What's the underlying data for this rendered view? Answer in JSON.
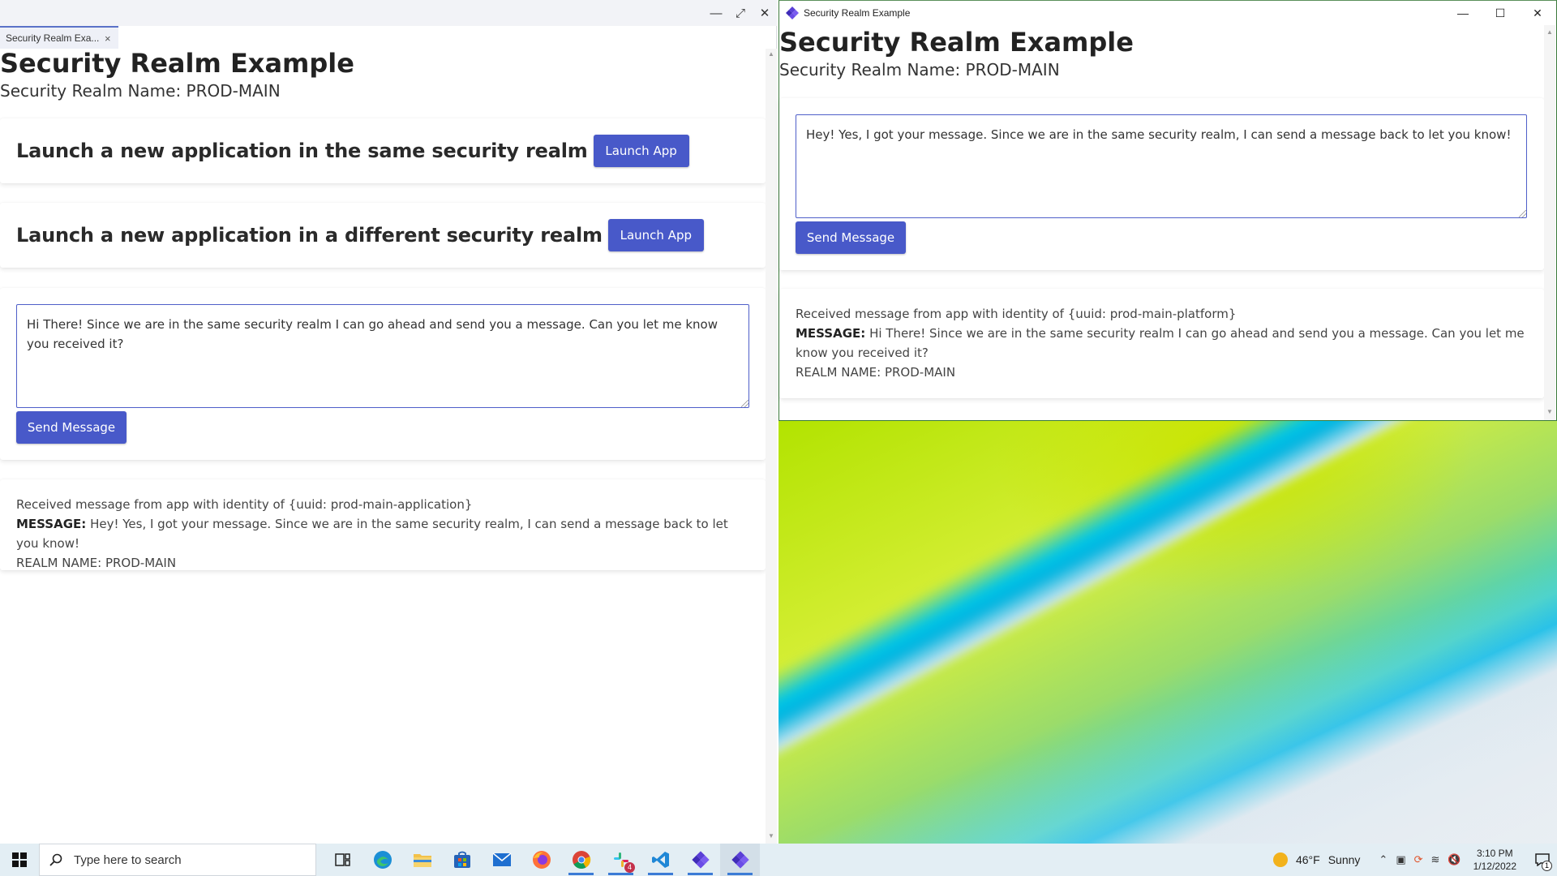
{
  "left_window": {
    "tab_label": "Security Realm Exa...",
    "tab_close": "×",
    "title": "Security Realm Example",
    "realm_name": "Security Realm Name: PROD-MAIN",
    "launch_same": {
      "heading": "Launch a new application in the same security realm",
      "button": "Launch App"
    },
    "launch_different": {
      "heading": "Launch a new application in a different security realm",
      "button": "Launch App"
    },
    "message_input": {
      "value": "Hi There! Since we are in the same security realm I can go ahead and send you a message. Can you let me know you received it?"
    },
    "send_button": "Send Message",
    "received": {
      "line1": "Received message from app with identity of {uuid: prod-main-application}",
      "message_label": "MESSAGE:",
      "message_text": "Hey! Yes, I got your message. Since we are in the same security realm, I can send a message back to let you know!",
      "realm": "REALM NAME: PROD-MAIN"
    }
  },
  "right_window": {
    "window_title": "Security Realm Example",
    "title": "Security Realm Example",
    "realm_name": "Security Realm Name: PROD-MAIN",
    "message_input": {
      "value": "Hey! Yes, I got your message. Since we are in the same security realm, I can send a message back to let you know!"
    },
    "send_button": "Send Message",
    "received": {
      "line1": "Received message from app with identity of {uuid: prod-main-platform}",
      "message_label": "MESSAGE:",
      "message_text": "Hi There! Since we are in the same security realm I can go ahead and send you a message. Can you let me know you received it?",
      "realm": "REALM NAME: PROD-MAIN"
    }
  },
  "taskbar": {
    "search_placeholder": "Type here to search",
    "apps": [
      "task-view",
      "edge",
      "file-explorer",
      "microsoft-store",
      "mail",
      "firefox",
      "chrome",
      "slack",
      "vscode",
      "openfin",
      "openfin"
    ],
    "slack_badge": "4",
    "weather_temp": "46°F",
    "weather_text": "Sunny",
    "time": "3:10 PM",
    "date": "1/12/2022",
    "notification_count": "1"
  },
  "colors": {
    "primary_button": "#4859c9",
    "textarea_border": "#4f5fc9",
    "taskbar": "#e3eef4"
  }
}
